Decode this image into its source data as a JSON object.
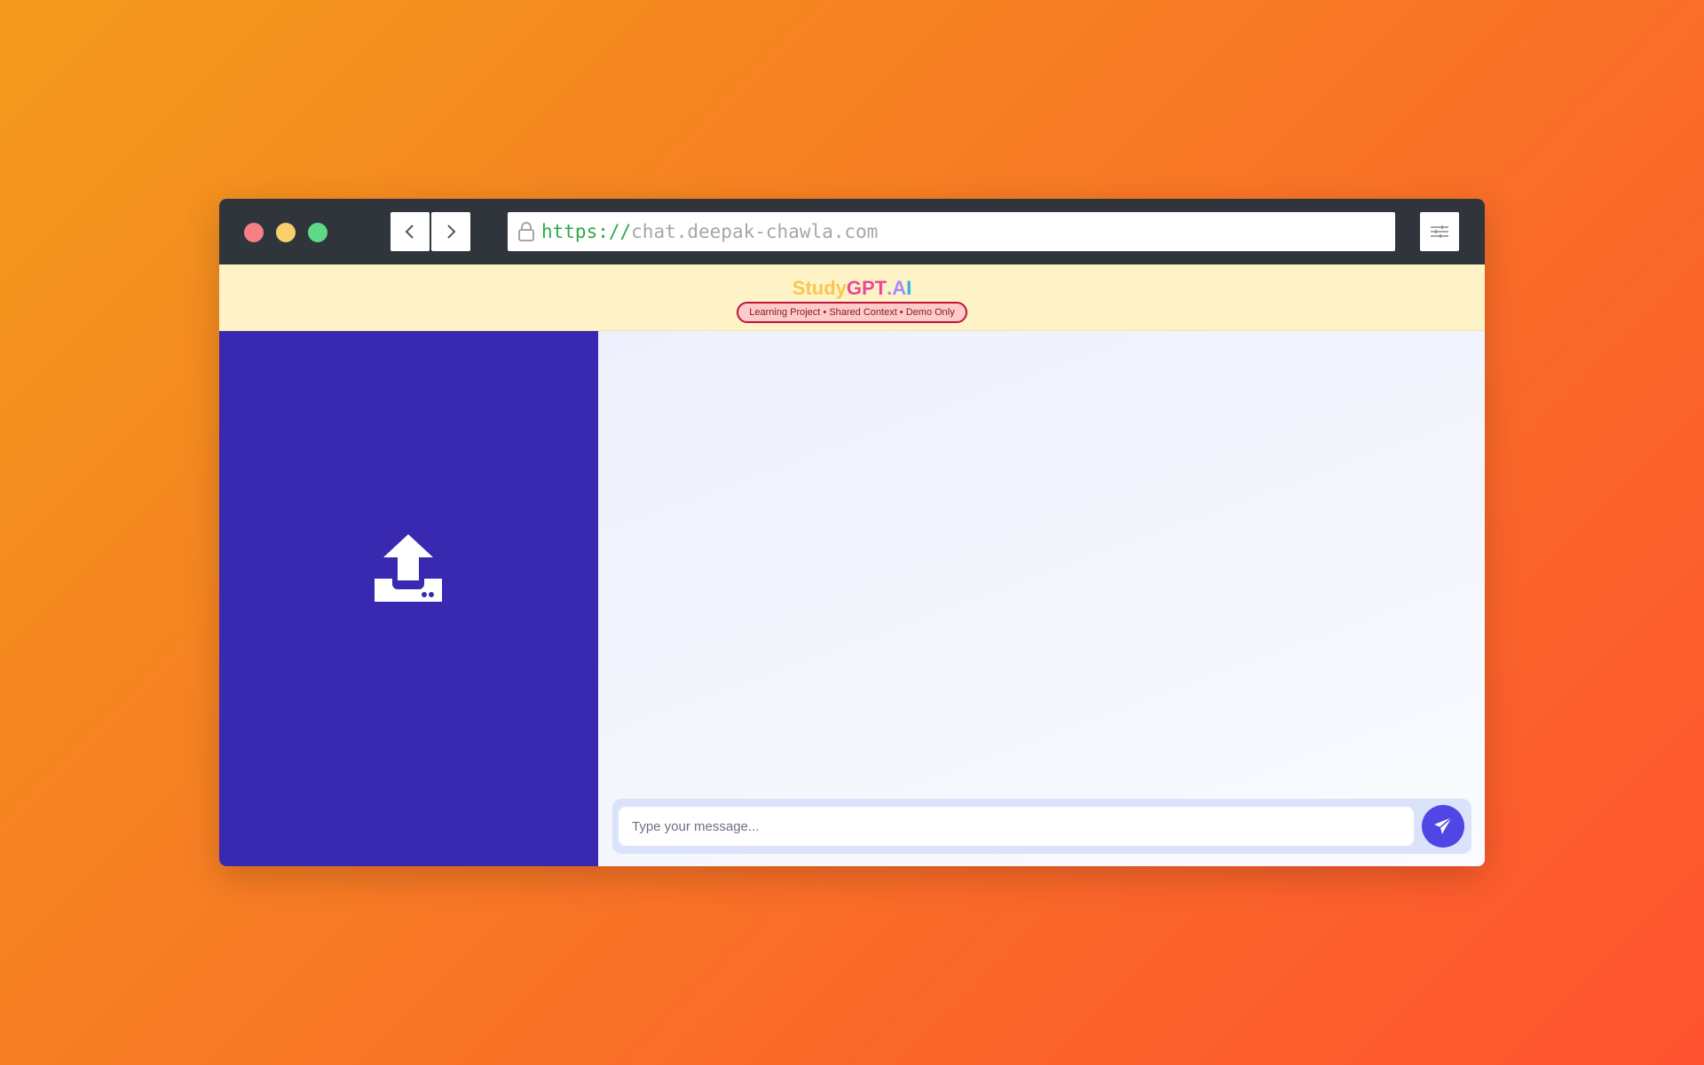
{
  "browser": {
    "url_scheme": "https://",
    "url_host": "chat.deepak-chawla.com"
  },
  "header": {
    "brand_parts": [
      "Study",
      "GPT",
      ".",
      "A",
      "I"
    ],
    "badge": "Learning Project • Shared Context • Demo Only"
  },
  "sidebar": {
    "upload_icon": "upload-icon"
  },
  "composer": {
    "placeholder": "Type your message...",
    "value": "",
    "send_icon": "paper-plane-icon"
  },
  "colors": {
    "background_start": "#f39a1c",
    "background_end": "#ff5230",
    "titlebar": "#2f353b",
    "banner": "#fef3c7",
    "sidebar": "#3829b0",
    "accent": "#4f46e5",
    "url_scheme": "#2ea84a"
  }
}
